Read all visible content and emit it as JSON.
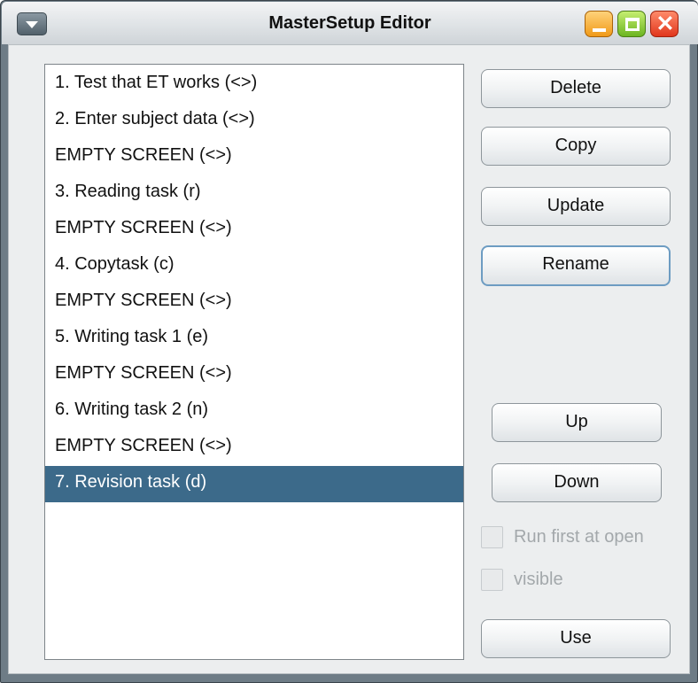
{
  "window": {
    "title": "MasterSetup Editor",
    "close_glyph": "✕",
    "icons": [
      "window-menu-icon",
      "minimize-icon",
      "maximize-icon",
      "close-icon"
    ],
    "colors": {
      "selection": "#3c6a8a",
      "minimize": "#f09a18",
      "maximize": "#6cb521",
      "close": "#e0361c"
    }
  },
  "list": {
    "items": [
      "1. Test that ET works (<>)",
      "2. Enter subject data (<>)",
      "EMPTY SCREEN (<>)",
      "3. Reading task (r)",
      "EMPTY SCREEN (<>)",
      "4. Copytask (c)",
      "EMPTY SCREEN (<>)",
      "5. Writing task 1 (e)",
      "EMPTY SCREEN (<>)",
      "6. Writing task 2 (n)",
      "EMPTY SCREEN (<>)",
      "7. Revision task (d)"
    ],
    "selected_item": "7. Revision task (d)"
  },
  "buttons": {
    "delete": "Delete",
    "copy": "Copy",
    "update": "Update",
    "rename": "Rename",
    "up": "Up",
    "down": "Down",
    "use": "Use"
  },
  "checkboxes": {
    "run_first_at_open": {
      "label": "Run first at open",
      "checked": false,
      "enabled": false
    },
    "visible": {
      "label": "visible",
      "checked": false,
      "enabled": false
    }
  }
}
